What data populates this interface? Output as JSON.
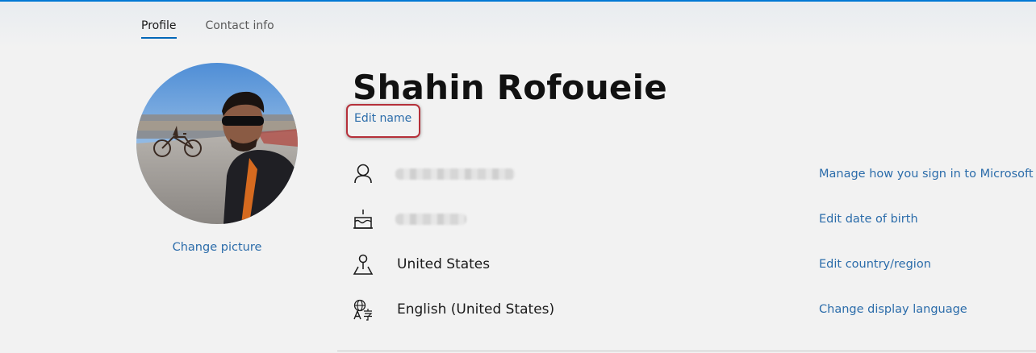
{
  "tabs": [
    {
      "label": "Profile",
      "active": true
    },
    {
      "label": "Contact info",
      "active": false
    }
  ],
  "profile": {
    "name": "Shahin Rofoueie",
    "edit_name_label": "Edit name",
    "change_picture_label": "Change picture"
  },
  "rows": [
    {
      "icon": "person-icon",
      "value": "",
      "blurred": true,
      "action": "Manage how you sign in to Microsoft"
    },
    {
      "icon": "birthday-cake-icon",
      "value": "",
      "blurred": true,
      "action": "Edit date of birth"
    },
    {
      "icon": "map-pin-icon",
      "value": "United States",
      "blurred": false,
      "action": "Edit country/region"
    },
    {
      "icon": "language-icon",
      "value": "English (United States)",
      "blurred": false,
      "action": "Change display language"
    }
  ],
  "colors": {
    "link": "#2b6caa",
    "accent": "#0078d4",
    "highlight_border": "#b5303a",
    "background": "#f2f2f2"
  }
}
